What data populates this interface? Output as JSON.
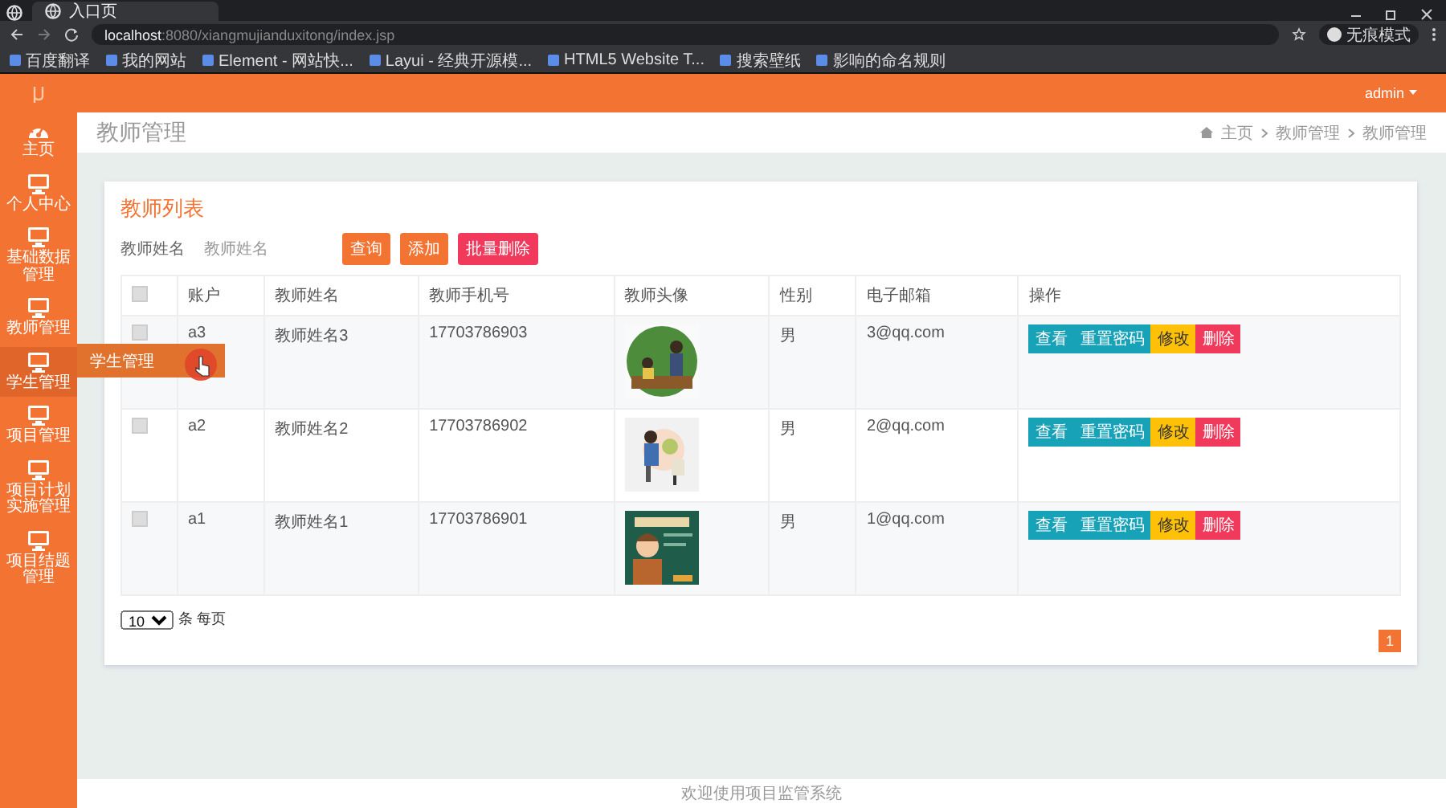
{
  "browser": {
    "tabs": [
      {
        "label": "入口页",
        "selected": true
      }
    ],
    "url_host": "localhost",
    "url_rest": ":8080/xiangmujianduxitong/index.jsp",
    "profile_label": "无痕模式",
    "bookmarks": [
      {
        "label": "百度翻译"
      },
      {
        "label": "我的网站"
      },
      {
        "label": "Element - 网站快..."
      },
      {
        "label": "Layui - 经典开源模..."
      },
      {
        "label": "HTML5 Website T..."
      },
      {
        "label": "搜索壁纸"
      },
      {
        "label": "影响的命名规则"
      }
    ]
  },
  "header": {
    "user": "admin"
  },
  "sidebar": {
    "items": [
      {
        "label": "主页",
        "kind": "home",
        "selected": false
      },
      {
        "label": "个人中心",
        "kind": "monitor",
        "selected": false
      },
      {
        "label": "基础数据管理",
        "kind": "monitor",
        "selected": false
      },
      {
        "label": "教师管理",
        "kind": "monitor",
        "selected": false
      },
      {
        "label": "学生管理",
        "kind": "monitor",
        "selected": true
      },
      {
        "label": "项目管理",
        "kind": "monitor",
        "selected": false
      },
      {
        "label": "项目计划实施管理",
        "kind": "monitor",
        "selected": false
      },
      {
        "label": "项目结题管理",
        "kind": "monitor",
        "selected": false
      }
    ],
    "flyout": {
      "label": "学生管理"
    }
  },
  "page": {
    "title": "教师管理",
    "breadcrumb": [
      "主页",
      "教师管理",
      "教师管理"
    ]
  },
  "card": {
    "title": "教师列表",
    "search": {
      "label": "教师姓名",
      "placeholder": "教师姓名"
    },
    "buttons": [
      {
        "label": "查询",
        "kind": "primary"
      },
      {
        "label": "添加",
        "kind": "primary"
      },
      {
        "label": "批量删除",
        "kind": "danger"
      }
    ],
    "table": {
      "select_all_checked": false,
      "columns": [
        "账户",
        "教师姓名",
        "教师手机号",
        "教师头像",
        "性别",
        "电子邮箱",
        "操作"
      ],
      "rows": [
        {
          "checked": false,
          "account": "a3",
          "name": "教师姓名3",
          "phone": "17703786903",
          "gender": "男",
          "email": "3@qq.com",
          "actions": [
            {
              "label": "查看",
              "kind": "info"
            },
            {
              "label": "重置密码",
              "kind": "info"
            },
            {
              "label": "修改",
              "kind": "warning"
            },
            {
              "label": "删除",
              "kind": "danger"
            }
          ]
        },
        {
          "checked": false,
          "account": "a2",
          "name": "教师姓名2",
          "phone": "17703786902",
          "gender": "男",
          "email": "2@qq.com",
          "actions": [
            {
              "label": "查看",
              "kind": "info"
            },
            {
              "label": "重置密码",
              "kind": "info"
            },
            {
              "label": "修改",
              "kind": "warning"
            },
            {
              "label": "删除",
              "kind": "danger"
            }
          ]
        },
        {
          "checked": false,
          "account": "a1",
          "name": "教师姓名1",
          "phone": "17703786901",
          "gender": "男",
          "email": "1@qq.com",
          "actions": [
            {
              "label": "查看",
              "kind": "info"
            },
            {
              "label": "重置密码",
              "kind": "info"
            },
            {
              "label": "修改",
              "kind": "warning"
            },
            {
              "label": "删除",
              "kind": "danger"
            }
          ]
        }
      ]
    },
    "pagination": {
      "page_size": "10",
      "per_page_label": "条 每页",
      "pages": [
        {
          "label": "1",
          "selected": true
        }
      ]
    }
  },
  "footer": "欢迎使用项目监管系统"
}
